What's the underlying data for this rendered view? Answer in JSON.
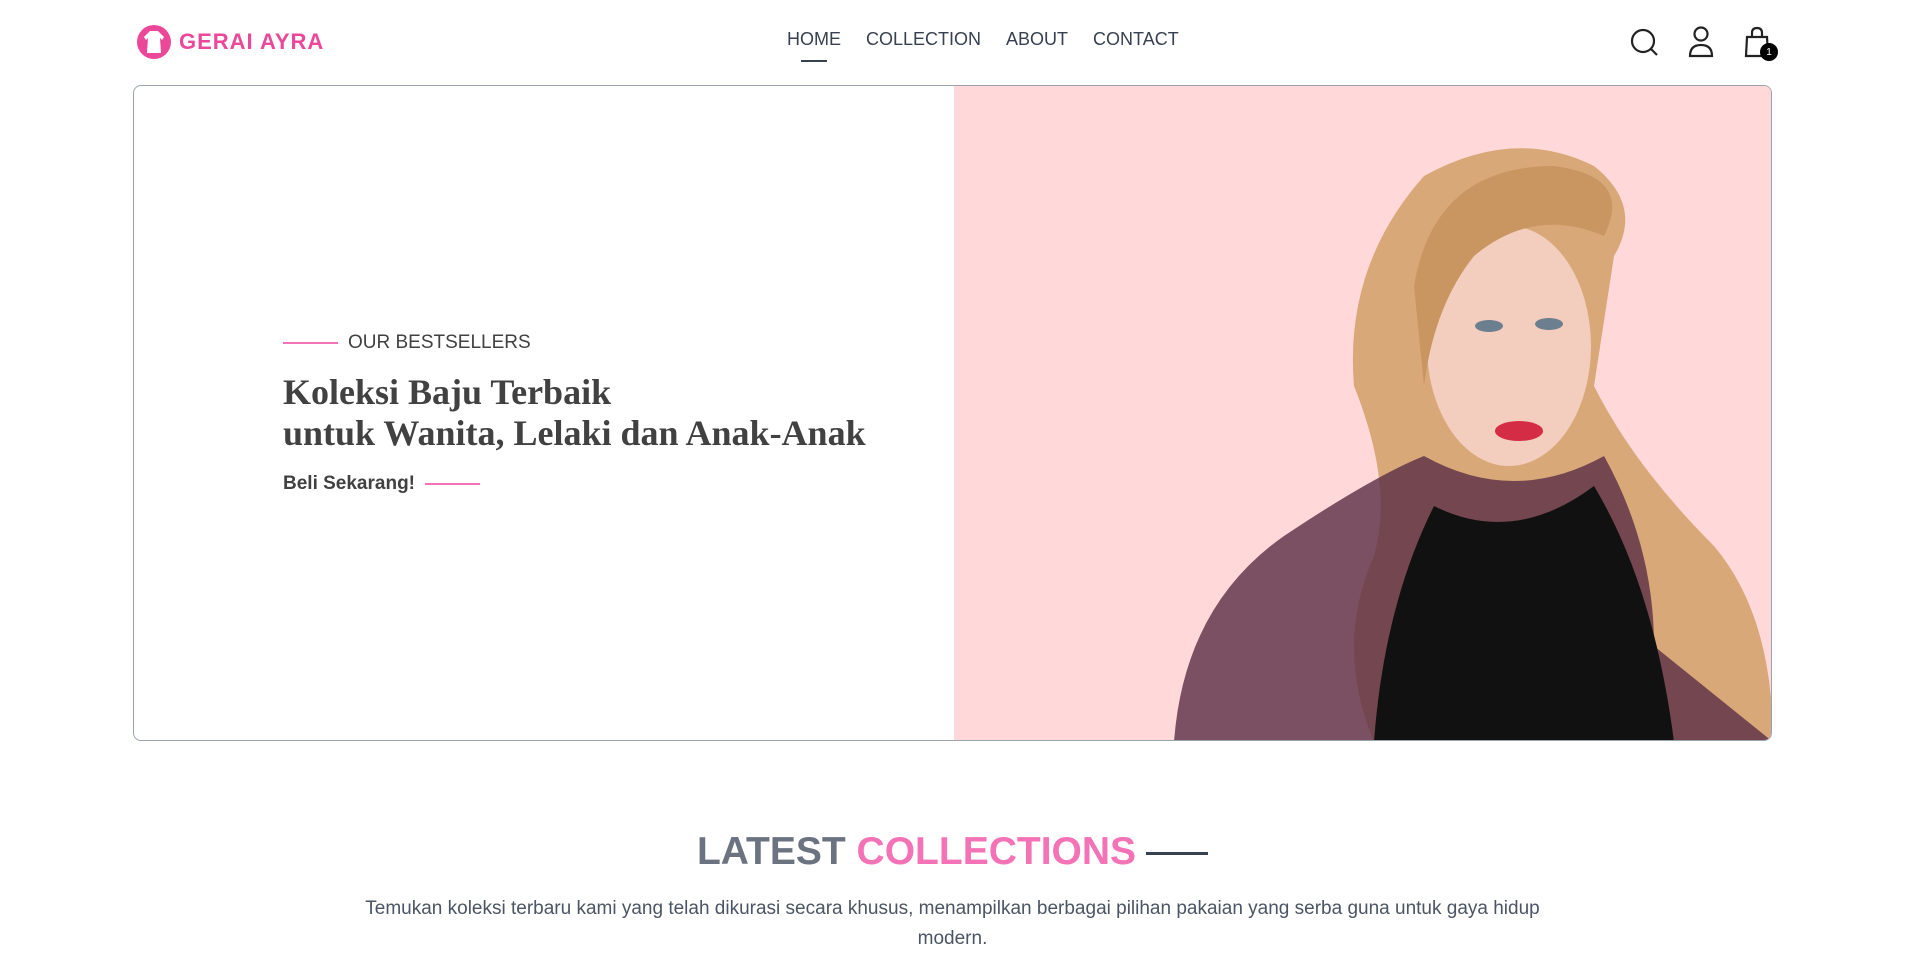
{
  "brand": {
    "name": "GERAI AYRA",
    "color": "#ec4899"
  },
  "nav": {
    "items": [
      {
        "label": "HOME",
        "active": true
      },
      {
        "label": "COLLECTION"
      },
      {
        "label": "ABOUT"
      },
      {
        "label": "CONTACT"
      }
    ]
  },
  "header_icons": {
    "search": "search-icon",
    "profile": "user-icon",
    "cart": "shopping-bag-icon",
    "cart_count": "1"
  },
  "hero": {
    "tagline": "OUR BESTSELLERS",
    "title_line1": "Koleksi Baju Terbaik",
    "title_line2": "untuk Wanita, Lelaki dan Anak-Anak",
    "cta": "Beli Sekarang!",
    "accent": "#f472b6",
    "image_bg": "#ffd9d9"
  },
  "latest": {
    "title_part1": "LATEST",
    "title_part2": "COLLECTIONS",
    "description": "Temukan koleksi terbaru kami yang telah dikurasi secara khusus, menampilkan berbagai pilihan pakaian yang serba guna untuk gaya hidup modern."
  }
}
